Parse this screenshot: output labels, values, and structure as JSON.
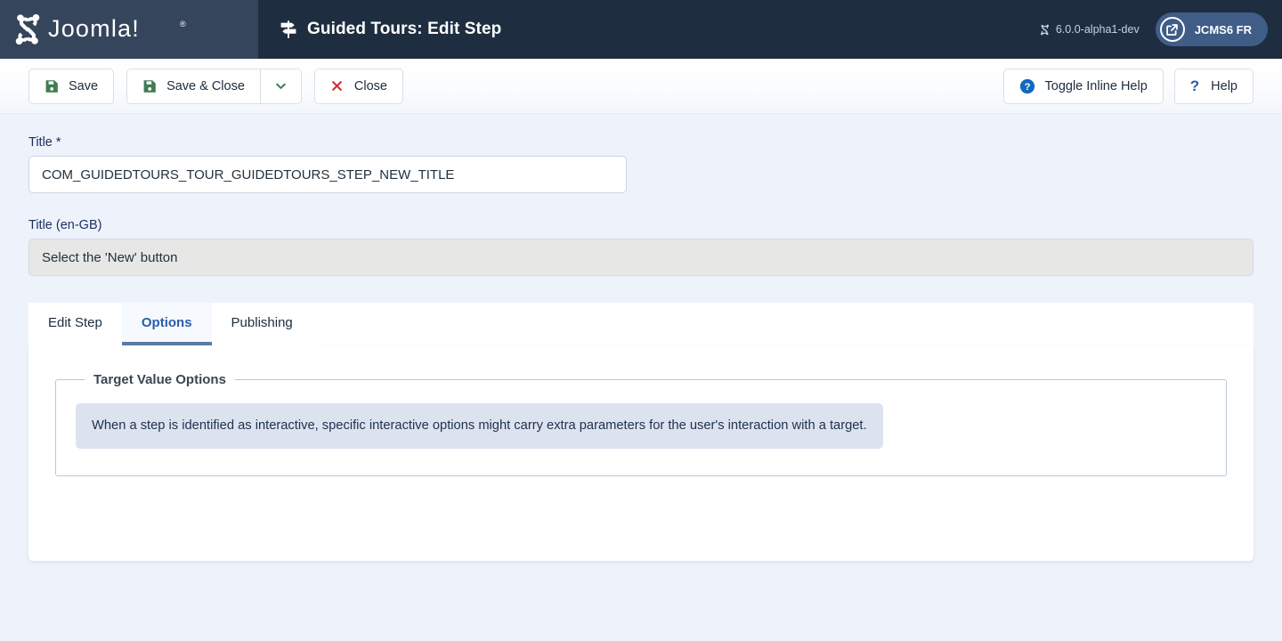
{
  "header": {
    "logo_alt": "Joomla!",
    "logo_icon": "joomla-logo-icon",
    "title": "Guided Tours: Edit Step",
    "title_icon": "signpost-icon",
    "version": "6.0.0-alpha1-dev",
    "version_icon": "joomla-mark-icon",
    "site_name": "JCMS6 FR",
    "site_icon": "external-link-icon"
  },
  "toolbar": {
    "save_label": "Save",
    "save_icon": "floppy-disk-icon",
    "save_close_label": "Save & Close",
    "save_close_icon": "floppy-disk-icon",
    "dropdown_icon": "chevron-down-icon",
    "close_label": "Close",
    "close_icon": "x-icon",
    "toggle_help_label": "Toggle Inline Help",
    "toggle_help_icon": "question-circle-icon",
    "help_label": "Help",
    "help_icon": "question-mark-icon"
  },
  "form": {
    "title_label": "Title",
    "title_required_mark": "*",
    "title_value": "COM_GUIDEDTOURS_TOUR_GUIDEDTOURS_STEP_NEW_TITLE",
    "title_placeholder": "",
    "title_lang_label": "Title (en-GB)",
    "title_lang_value": "Select the 'New' button",
    "title_lang_placeholder": ""
  },
  "tabs": [
    {
      "label": "Edit Step",
      "active": false
    },
    {
      "label": "Options",
      "active": true
    },
    {
      "label": "Publishing",
      "active": false
    }
  ],
  "panel": {
    "fieldset_legend": "Target Value Options",
    "alert_text": "When a step is identified as interactive, specific interactive options might carry extra parameters for the user's interaction with a target."
  },
  "colors": {
    "header_bg": "#1f2d40",
    "logo_bg": "#35455c",
    "page_bg": "#eef2fb",
    "accent_blue": "#2a5caa",
    "tab_underline": "#5b7ba6",
    "save_green": "#3f7d52",
    "close_red": "#cc2936",
    "alert_bg": "#dde3ee",
    "pill_bg": "#3f5d87"
  }
}
